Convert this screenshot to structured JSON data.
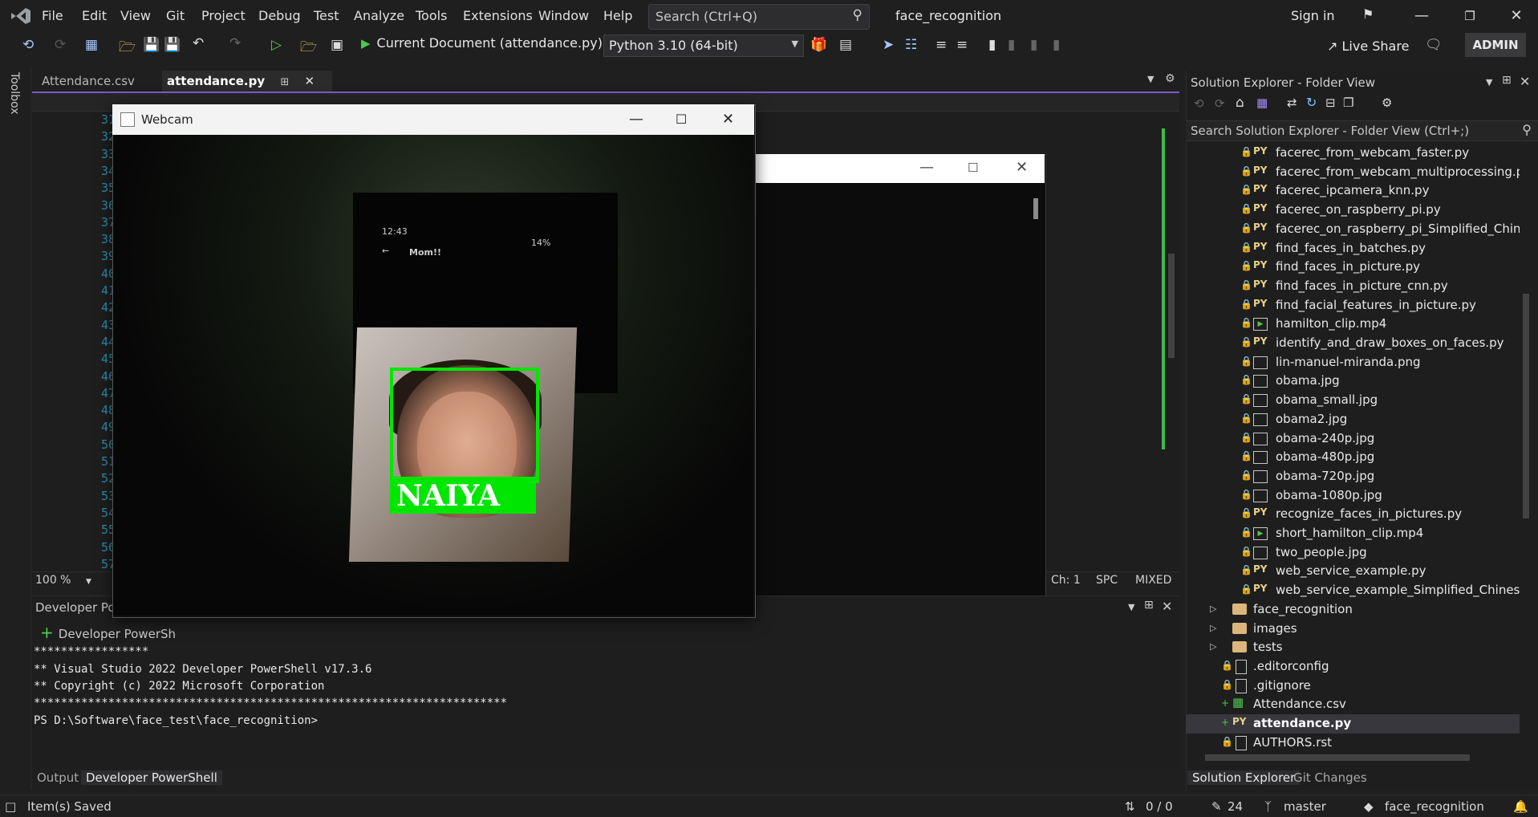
{
  "menubar": {
    "items": [
      "File",
      "Edit",
      "View",
      "Git",
      "Project",
      "Debug",
      "Test",
      "Analyze",
      "Tools",
      "Extensions",
      "Window",
      "Help"
    ],
    "search_placeholder": "Search (Ctrl+Q)",
    "solution_name": "face_recognition",
    "sign_in": "Sign in"
  },
  "toolbar": {
    "run_target": "Current Document (attendance.py)",
    "python_env": "Python 3.10 (64-bit)",
    "live_share": "Live Share",
    "admin": "ADMIN"
  },
  "toolbox": {
    "label": "Toolbox"
  },
  "editor": {
    "tabs": [
      {
        "label": "Attendance.csv",
        "active": false
      },
      {
        "label": "attendance.py",
        "active": true
      }
    ],
    "line_numbers": [
      "31",
      "32",
      "33",
      "34",
      "35",
      "36",
      "37",
      "38",
      "39",
      "40",
      "41",
      "42",
      "43",
      "44",
      "45",
      "46",
      "47",
      "48",
      "49",
      "50",
      "51",
      "52",
      "53",
      "54",
      "55",
      "56",
      "57"
    ],
    "zoom": "100 %",
    "ch": "Ch: 1",
    "spc": "SPC",
    "line_endings": "MIXED"
  },
  "webcam_window": {
    "title": "Webcam",
    "phone_time": "12:43",
    "phone_header": "Mom!!",
    "phone_battery": "14%",
    "detected_name": "NAIYA",
    "box_color": "#00e600"
  },
  "terminal": {
    "panel_title": "Developer Pow",
    "new_tab_label": "Developer PowerSh",
    "lines": [
      "*****************",
      "** Visual Studio 2022 Developer PowerShell v17.3.6",
      "** Copyright (c) 2022 Microsoft Corporation",
      "**********************************************************************",
      "PS D:\\Software\\face_test\\face_recognition>"
    ],
    "tabs": [
      "Output",
      "Developer PowerShell"
    ]
  },
  "solution_explorer": {
    "title": "Solution Explorer - Folder View",
    "search_placeholder": "Search Solution Explorer - Folder View (Ctrl+;)",
    "items": [
      {
        "name": "facerec_from_webcam_faster.py",
        "type": "py"
      },
      {
        "name": "facerec_from_webcam_multiprocessing.py",
        "type": "py"
      },
      {
        "name": "facerec_ipcamera_knn.py",
        "type": "py"
      },
      {
        "name": "facerec_on_raspberry_pi.py",
        "type": "py"
      },
      {
        "name": "facerec_on_raspberry_pi_Simplified_Chinese.py",
        "type": "py"
      },
      {
        "name": "find_faces_in_batches.py",
        "type": "py"
      },
      {
        "name": "find_faces_in_picture.py",
        "type": "py"
      },
      {
        "name": "find_faces_in_picture_cnn.py",
        "type": "py"
      },
      {
        "name": "find_facial_features_in_picture.py",
        "type": "py"
      },
      {
        "name": "hamilton_clip.mp4",
        "type": "video"
      },
      {
        "name": "identify_and_draw_boxes_on_faces.py",
        "type": "py"
      },
      {
        "name": "lin-manuel-miranda.png",
        "type": "image"
      },
      {
        "name": "obama.jpg",
        "type": "image"
      },
      {
        "name": "obama_small.jpg",
        "type": "image"
      },
      {
        "name": "obama2.jpg",
        "type": "image"
      },
      {
        "name": "obama-240p.jpg",
        "type": "image"
      },
      {
        "name": "obama-480p.jpg",
        "type": "image"
      },
      {
        "name": "obama-720p.jpg",
        "type": "image"
      },
      {
        "name": "obama-1080p.jpg",
        "type": "image"
      },
      {
        "name": "recognize_faces_in_pictures.py",
        "type": "py"
      },
      {
        "name": "short_hamilton_clip.mp4",
        "type": "video"
      },
      {
        "name": "two_people.jpg",
        "type": "image"
      },
      {
        "name": "web_service_example.py",
        "type": "py"
      },
      {
        "name": "web_service_example_Simplified_Chinese.py",
        "type": "py"
      },
      {
        "name": "face_recognition",
        "type": "folder"
      },
      {
        "name": "images",
        "type": "folder"
      },
      {
        "name": "tests",
        "type": "folder"
      },
      {
        "name": ".editorconfig",
        "type": "doc"
      },
      {
        "name": ".gitignore",
        "type": "doc"
      },
      {
        "name": "Attendance.csv",
        "type": "csv"
      },
      {
        "name": "attendance.py",
        "type": "py-selected"
      },
      {
        "name": "AUTHORS.rst",
        "type": "doc"
      }
    ],
    "tabs": [
      "Solution Explorer",
      "Git Changes"
    ]
  },
  "statusbar": {
    "message": "Item(s) Saved",
    "sync": "0 / 0",
    "edits": "24",
    "branch": "master",
    "repo": "face_recognition"
  }
}
